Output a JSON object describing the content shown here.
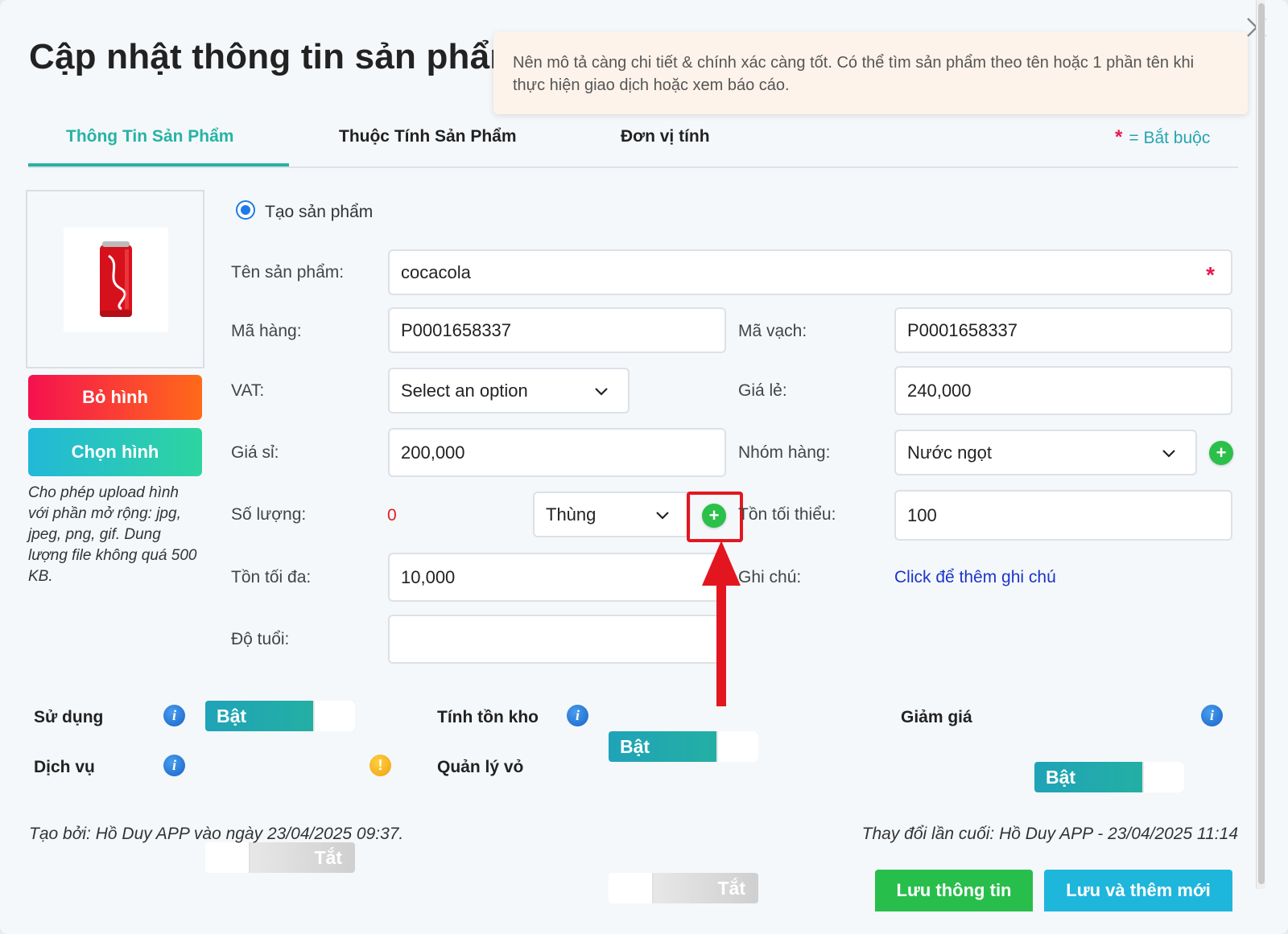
{
  "modal": {
    "title": "Cập nhật thông tin sản phẩm",
    "tooltip": "Nên mô tả càng chi tiết & chính xác càng tốt. Có thể tìm sản phẩm theo tên hoặc 1 phần tên khi thực hiện giao dịch hoặc xem báo cáo."
  },
  "tabs": [
    {
      "label": "Thông Tin Sản Phẩm",
      "active": true
    },
    {
      "label": "Thuộc Tính Sản Phẩm"
    },
    {
      "label": "Đơn vị tính"
    }
  ],
  "required_note": {
    "star": "*",
    "text": "= Bắt buộc"
  },
  "image_panel": {
    "remove_label": "Bỏ hình",
    "choose_label": "Chọn hình",
    "note": "Cho phép upload hình với phần mở rộng: jpg, jpeg, png, gif. Dung lượng file không quá 500 KB."
  },
  "form": {
    "radio_label": "Tạo sản phẩm",
    "name_label": "Tên sản phẩm:",
    "name_value": "cocacola",
    "sku_label": "Mã hàng:",
    "sku_value": "P0001658337",
    "barcode_label": "Mã vạch:",
    "barcode_value": "P0001658337",
    "vat_label": "VAT:",
    "vat_value": "Select an option",
    "retail_label": "Giá lẻ:",
    "retail_value": "240,000",
    "wholesale_label": "Giá sỉ:",
    "wholesale_value": "200,000",
    "group_label": "Nhóm hàng:",
    "group_value": "Nước ngọt",
    "qty_label": "Số lượng:",
    "qty_value": "0",
    "unit_value": "Thùng",
    "min_stock_label": "Tồn tối thiểu:",
    "min_stock_value": "100",
    "max_stock_label": "Tồn tối đa:",
    "max_stock_value": "10,000",
    "note_label": "Ghi chú:",
    "note_link": "Click để thêm ghi chú",
    "age_label": "Độ tuổi:",
    "age_value": ""
  },
  "switches": {
    "use_label": "Sử dụng",
    "use_state": "Bật",
    "stock_label": "Tính tồn kho",
    "stock_state": "Bật",
    "discount_label": "Giảm giá",
    "discount_state": "Bật",
    "service_label": "Dịch vụ",
    "service_state": "Tắt",
    "shell_label": "Quản lý vỏ",
    "shell_state": "Tắt"
  },
  "footer": {
    "created": "Tạo bởi: Hồ Duy APP vào ngày 23/04/2025 09:37.",
    "modified": "Thay đổi lần cuối: Hồ Duy APP - 23/04/2025 11:14",
    "save_label": "Lưu thông tin",
    "save_new_label": "Lưu và thêm mới"
  },
  "colors": {
    "accent": "#26b3a5",
    "required": "#e8194f",
    "highlight": "#e3161f",
    "add_green": "#2bc04a"
  },
  "icons": [
    "close-icon",
    "chevron-down-icon",
    "plus-icon",
    "info-icon",
    "warning-icon",
    "product-image",
    "annotation-arrow"
  ]
}
